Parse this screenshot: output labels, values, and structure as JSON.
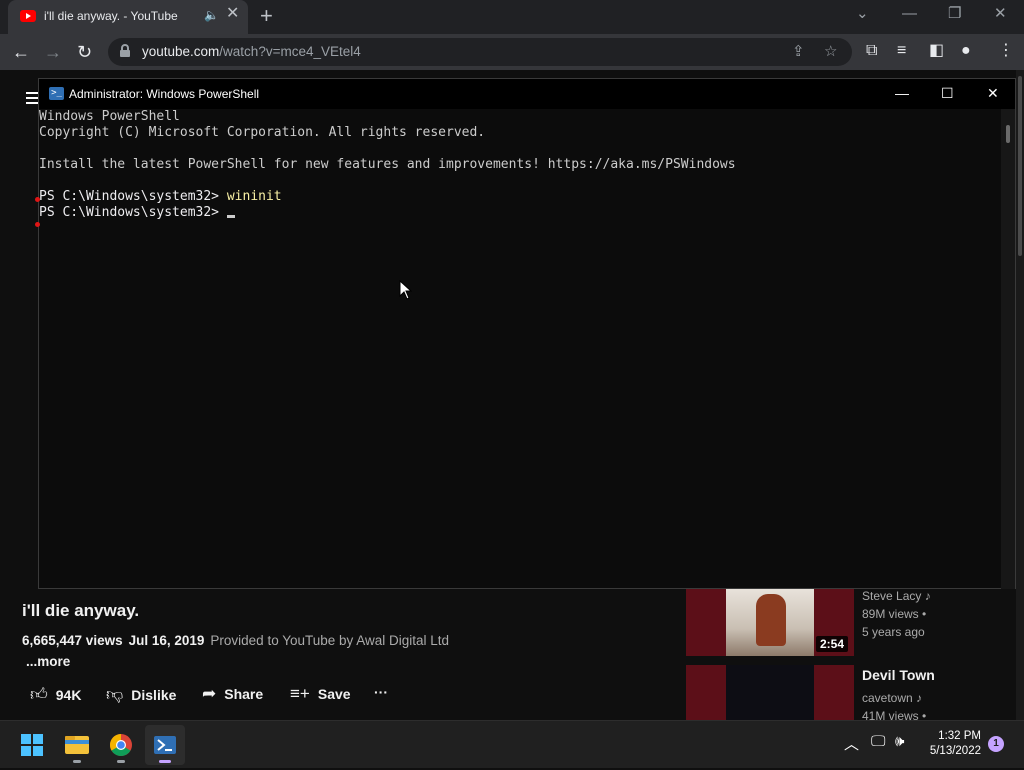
{
  "browser": {
    "tab_title": "i'll die anyway. - YouTube",
    "tab_audio_icon": "speaker-icon",
    "url_host": "youtube.com",
    "url_path": "/watch?v=mce4_VEtel4"
  },
  "youtube": {
    "video": {
      "title": "i'll die anyway.",
      "views": "6,665,447 views",
      "date": "Jul 16, 2019",
      "provided": "Provided to YouTube by Awal Digital Ltd",
      "more": "...more"
    },
    "actions": {
      "like_count": "94K",
      "dislike_label": "Dislike",
      "share_label": "Share",
      "save_label": "Save"
    },
    "recommendations": [
      {
        "title": "",
        "channel": "Steve Lacy",
        "views": "89M views",
        "age": "5 years ago",
        "duration": "2:54"
      },
      {
        "title": "Devil Town",
        "channel": "cavetown",
        "views": "41M views"
      }
    ]
  },
  "powershell": {
    "title": "Administrator: Windows PowerShell",
    "lines": [
      "Windows PowerShell",
      "Copyright (C) Microsoft Corporation. All rights reserved.",
      "",
      "Install the latest PowerShell for new features and improvements! https://aka.ms/PSWindows",
      ""
    ],
    "prompt": "PS C:\\Windows\\system32> ",
    "command": "wininit"
  },
  "taskbar": {
    "time": "1:32 PM",
    "date": "5/13/2022",
    "notification_count": "1",
    "apps": [
      "start-icon",
      "file-explorer-icon",
      "chrome-icon",
      "powershell-icon"
    ]
  },
  "colors": {
    "youtube_red": "#ff0000",
    "ps_command_arg": "#f9f1a5",
    "accent": "#c5a3ff"
  }
}
